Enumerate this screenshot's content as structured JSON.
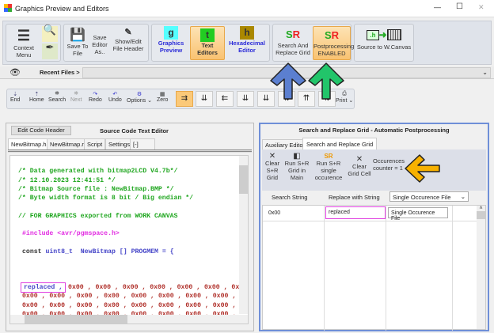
{
  "window": {
    "title": "Graphics Preview and Editors",
    "minimize": "—",
    "maximize": "☐",
    "close": "✕"
  },
  "ribbon": {
    "context_menu": "Context Menu",
    "save_to_file": "Save To File",
    "save_editor_as": "Save Editor As..",
    "show_edit_header": "Show/Edit File Header",
    "graphics_preview": "Graphics Preview",
    "graphics_icon": "g",
    "text_editors": "Text Editors",
    "text_icon": "t",
    "hex_editor": "Hexadecimal Editor",
    "hex_icon": "h",
    "search_replace_grid": "Search And Replace Grid",
    "sr_icon": "SR",
    "postprocessing": "Postprocessing ENABLED",
    "source_to_canvas": "Source to W.Canvas",
    "h_icon": ".h"
  },
  "recent_files": "Recent Files >",
  "toolbar": {
    "end": "End",
    "home": "Home",
    "search": "Search",
    "next": "Next",
    "redo": "Redo",
    "undo": "Undo",
    "options": "Options",
    "zero": "Zero",
    "print": "Print"
  },
  "left": {
    "edit_code_header": "Edit Code Header",
    "title": "Source Code Text Editor",
    "tabs": [
      "NewBitmap.h",
      "NewBitmap.rtf",
      "Script",
      "Settings",
      "[-]"
    ],
    "code": {
      "l1": "/* Data generated with bitmap2LCD V4.7b*/",
      "l2": "/* 12.10.2023 12:41:51 */",
      "l3": "/* Bitmap Source file : NewBitmap.BMP */",
      "l4": "/* Byte width format is 8 bit / Big endian */",
      "l5": "// FOR GRAPHICS exported from WORK CANVAS",
      "l6": "#include <avr/pgmspace.h>",
      "l7a": "const ",
      "l7b": "uint8_t  NewBitmap [] PROGMEM = {",
      "replaced": "replaced ,",
      "r1": " 0x00 , 0x00 , 0x00 , 0x00 , 0x00 , 0x00 , 0x",
      "r2": "0x00 , 0x00 , 0x00 , 0x00 , 0x00 , 0x00 , 0x00 , 0x00 ,"
    }
  },
  "right": {
    "title": "Search and Replace Grid - Automatic Postprocessing",
    "tabs": [
      "Auxiliary Editor",
      "Search and Replace Grid"
    ],
    "buttons": {
      "clear_grid": "Clear S+R Grid",
      "run_main": "Run S+R Grid in Main",
      "run_single": "Run S+R single occurence",
      "clear_cell": "Clear Grid Cell",
      "counter": "Occurences counter = 1"
    },
    "headers": {
      "search": "Search String",
      "replace": "Replace with String",
      "mode": "Single Occurence File"
    },
    "row": {
      "search": "0x00",
      "replace": "replaced",
      "mode": "Single Occurence File"
    }
  },
  "colors": {
    "highlight": "#e040e0",
    "blue_arrow": "#5b7fd0",
    "green_arrow": "#22c56a",
    "orange_arrow": "#f7b100",
    "panel_border": "#6f8fd8"
  }
}
